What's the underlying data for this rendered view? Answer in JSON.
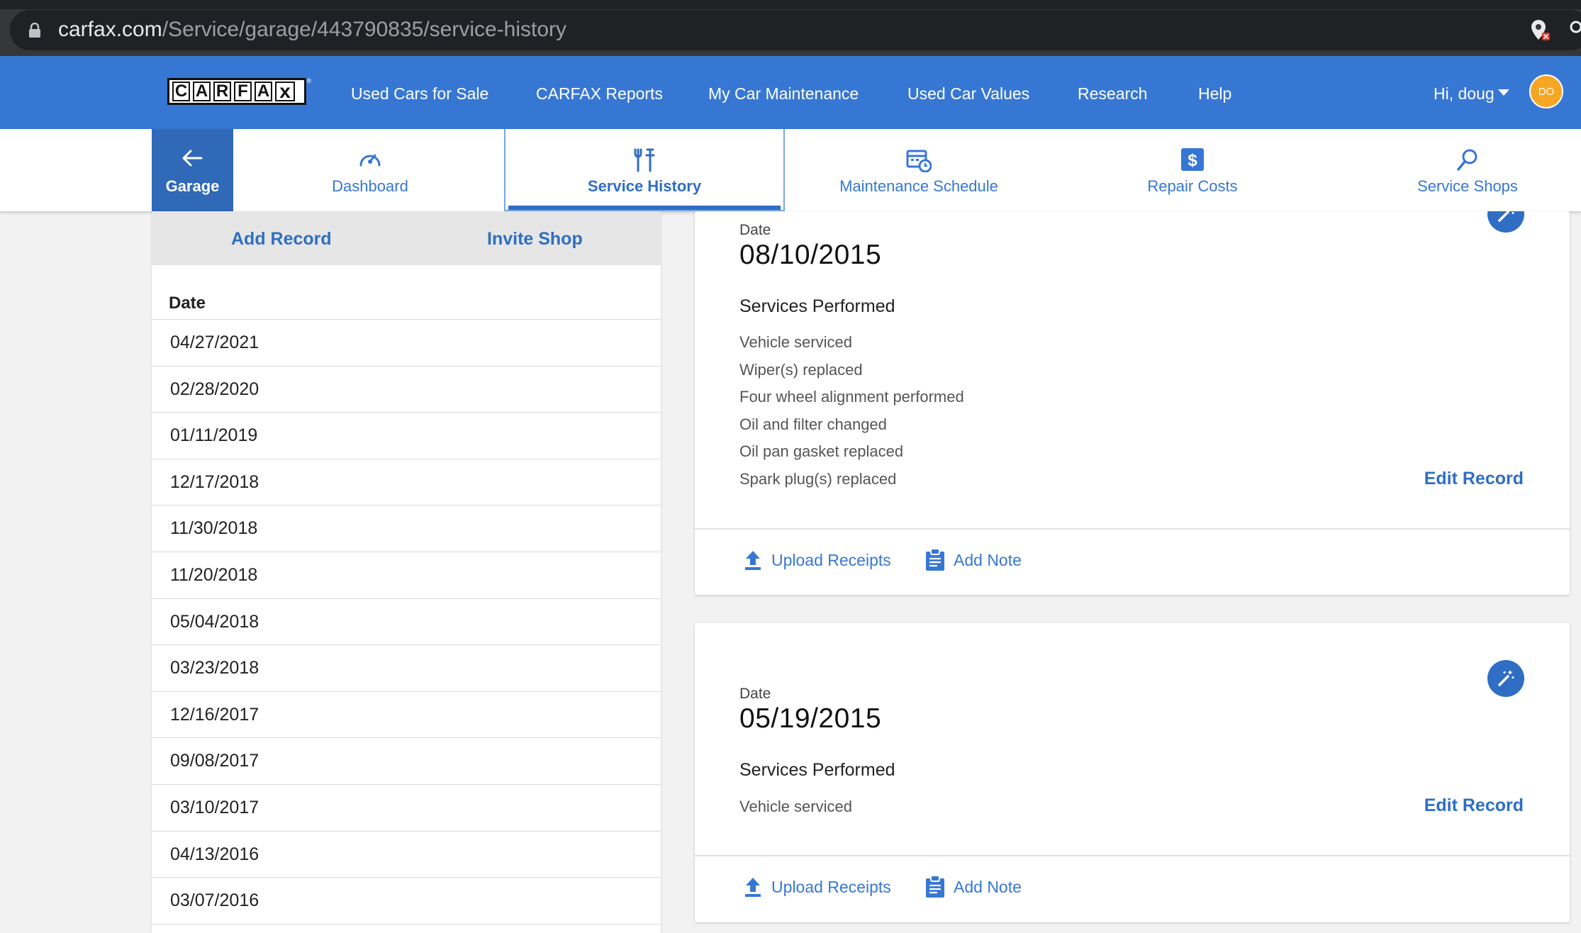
{
  "browser": {
    "url_host": "carfax.com",
    "url_path": "/Service/garage/443790835/service-history"
  },
  "header": {
    "logo_text": "CARFAX",
    "nav": [
      "Used Cars for Sale",
      "CARFAX Reports",
      "My Car Maintenance",
      "Used Car Values",
      "Research",
      "Help"
    ],
    "greeting": "Hi, doug",
    "avatar_initials": "DO"
  },
  "subnav": {
    "garage_label": "Garage",
    "tabs": [
      {
        "label": "Dashboard",
        "icon": "speedometer-icon"
      },
      {
        "label": "Service History",
        "icon": "tools-icon",
        "active": true
      },
      {
        "label": "Maintenance Schedule",
        "icon": "calendar-clock-icon"
      },
      {
        "label": "Repair Costs",
        "icon": "dollar-icon"
      },
      {
        "label": "Service Shops",
        "icon": "search-icon"
      }
    ]
  },
  "left_panel": {
    "add_record": "Add Record",
    "invite_shop": "Invite Shop",
    "date_header": "Date",
    "dates": [
      "04/27/2021",
      "02/28/2020",
      "01/11/2019",
      "12/17/2018",
      "11/30/2018",
      "11/20/2018",
      "05/04/2018",
      "03/23/2018",
      "12/16/2017",
      "09/08/2017",
      "03/10/2017",
      "04/13/2016",
      "03/07/2016"
    ]
  },
  "records": [
    {
      "date_label": "Date",
      "date": "08/10/2015",
      "services_title": "Services Performed",
      "services": [
        "Vehicle serviced",
        "Wiper(s) replaced",
        "Four wheel alignment performed",
        "Oil and filter changed",
        "Oil pan gasket replaced",
        "Spark plug(s) replaced"
      ],
      "edit_label": "Edit Record",
      "upload_label": "Upload Receipts",
      "note_label": "Add Note"
    },
    {
      "date_label": "Date",
      "date": "05/19/2015",
      "services_title": "Services Performed",
      "services": [
        "Vehicle serviced"
      ],
      "edit_label": "Edit Record",
      "upload_label": "Upload Receipts",
      "note_label": "Add Note"
    }
  ],
  "colors": {
    "header_blue": "#3777d4",
    "active_blue": "#2f6ec4",
    "avatar": "#f5a623"
  }
}
